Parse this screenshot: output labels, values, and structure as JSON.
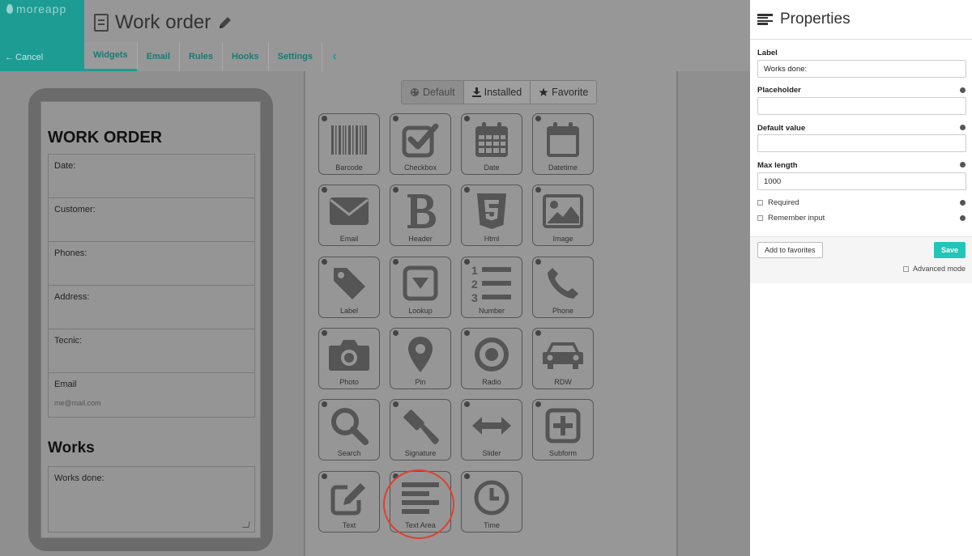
{
  "brand": {
    "logo_text": "moreapp",
    "cancel_label": "Cancel"
  },
  "header": {
    "title": "Work order"
  },
  "tabs": [
    {
      "label": "Widgets"
    },
    {
      "label": "Email"
    },
    {
      "label": "Rules"
    },
    {
      "label": "Hooks"
    },
    {
      "label": "Settings"
    }
  ],
  "preview": {
    "heading": "WORK ORDER",
    "fields": [
      {
        "label": "Date:",
        "sub": ""
      },
      {
        "label": "Customer:",
        "sub": ""
      },
      {
        "label": "Phones:",
        "sub": ""
      },
      {
        "label": "Address:",
        "sub": ""
      },
      {
        "label": "Tecnic:",
        "sub": ""
      },
      {
        "label": "Email",
        "sub": "me@mail.com"
      }
    ],
    "section": "Works",
    "textarea_label": "Works done:"
  },
  "widget_tabs": {
    "default": "Default",
    "installed": "Installed",
    "favorite": "Favorite"
  },
  "widgets": [
    {
      "label": "Barcode",
      "icon": "barcode-icon"
    },
    {
      "label": "Checkbox",
      "icon": "checkbox-icon"
    },
    {
      "label": "Date",
      "icon": "calendar-icon"
    },
    {
      "label": "Datetime",
      "icon": "calendar-blank-icon"
    },
    {
      "label": "Email",
      "icon": "envelope-icon"
    },
    {
      "label": "Header",
      "icon": "bold-b-icon"
    },
    {
      "label": "Html",
      "icon": "html5-icon"
    },
    {
      "label": "Image",
      "icon": "picture-icon"
    },
    {
      "label": "Label",
      "icon": "tag-icon"
    },
    {
      "label": "Lookup",
      "icon": "dropdown-icon"
    },
    {
      "label": "Number",
      "icon": "numbered-list-icon"
    },
    {
      "label": "Phone",
      "icon": "phone-icon"
    },
    {
      "label": "Photo",
      "icon": "camera-icon"
    },
    {
      "label": "Pin",
      "icon": "map-pin-icon"
    },
    {
      "label": "Radio",
      "icon": "radio-icon"
    },
    {
      "label": "RDW",
      "icon": "car-icon"
    },
    {
      "label": "Search",
      "icon": "magnifier-icon"
    },
    {
      "label": "Signature",
      "icon": "gavel-icon"
    },
    {
      "label": "Slider",
      "icon": "arrows-horizontal-icon"
    },
    {
      "label": "Subform",
      "icon": "plus-square-icon"
    },
    {
      "label": "Text",
      "icon": "pencil-square-icon"
    },
    {
      "label": "Text Area",
      "icon": "text-lines-icon"
    },
    {
      "label": "Time",
      "icon": "clock-icon"
    }
  ],
  "properties": {
    "title": "Properties",
    "label_caption": "Label",
    "label_value": "Works done:",
    "placeholder_caption": "Placeholder",
    "placeholder_value": "",
    "default_caption": "Default value",
    "default_value": "",
    "maxlength_caption": "Max length",
    "maxlength_value": "1000",
    "required_label": "Required",
    "remember_label": "Remember input",
    "add_favorites": "Add to favorites",
    "save": "Save",
    "advanced": "Advanced mode"
  }
}
